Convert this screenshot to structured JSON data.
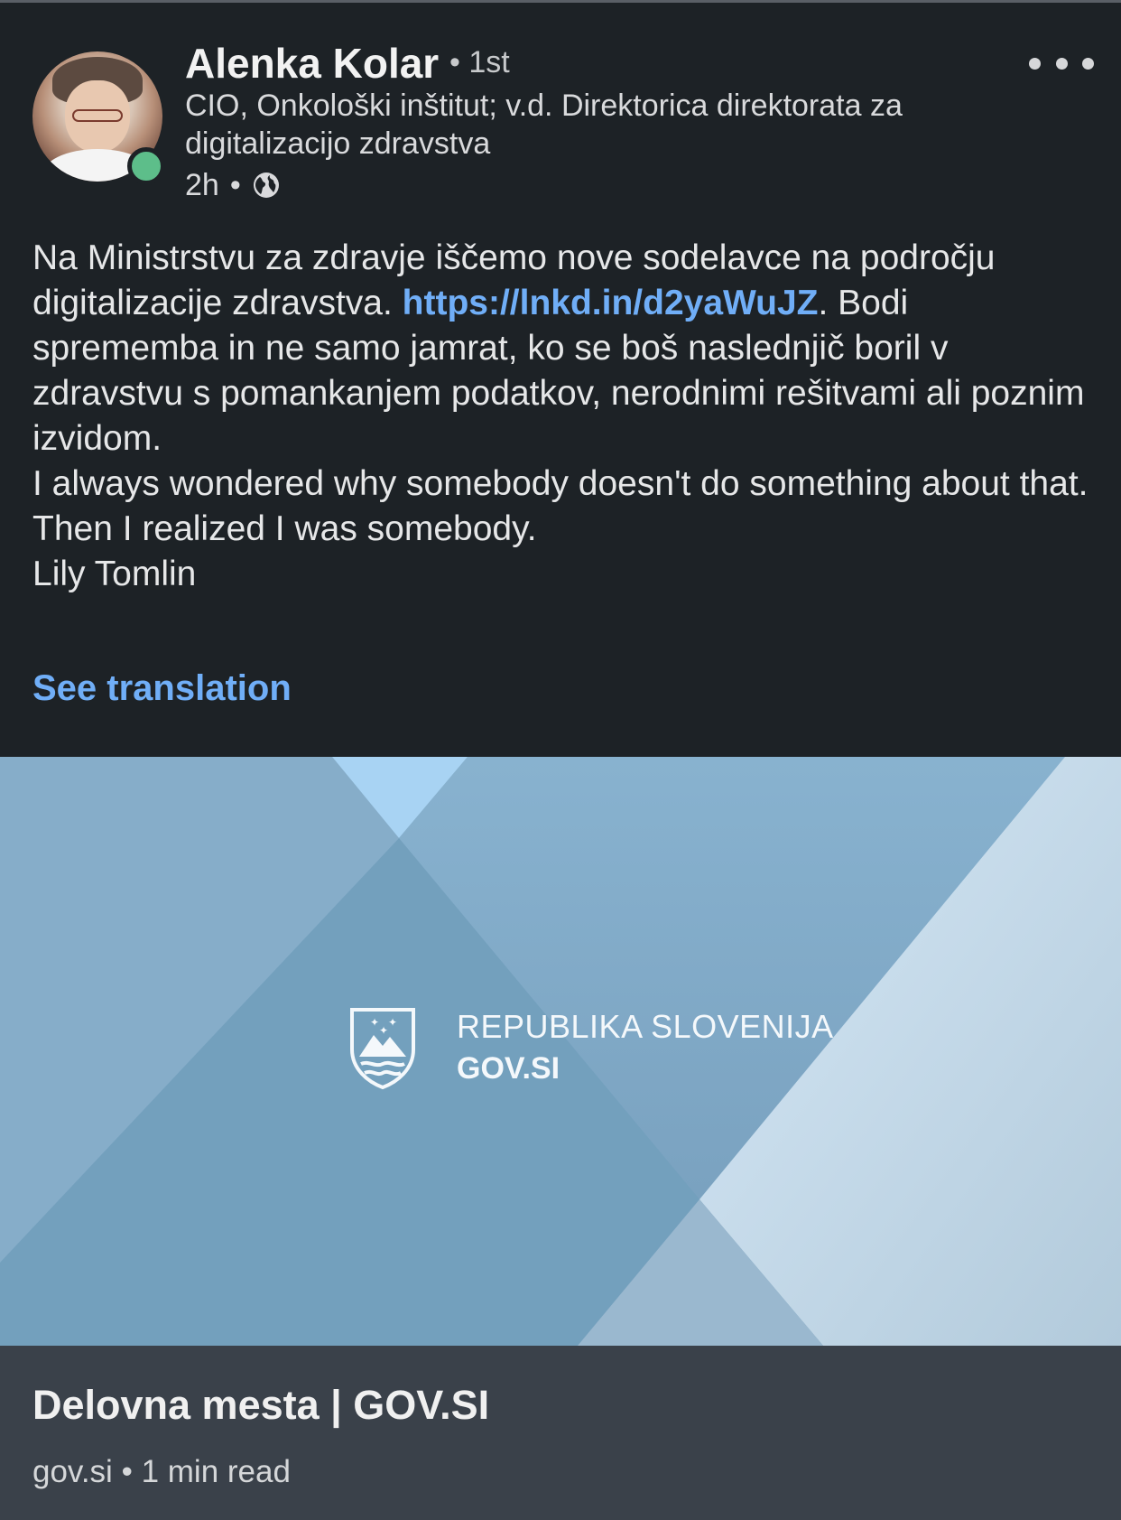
{
  "post": {
    "author_name": "Alenka Kolar",
    "connection_degree": "• 1st",
    "headline": "CIO, Onkološki inštitut; v.d. Direktorica direktorata za digitalizacijo zdravstva",
    "time_ago": "2h",
    "meta_separator": "•",
    "visibility_icon": "globe-icon",
    "more_icon": "more-options-icon",
    "body_part1": "Na Ministrstvu za zdravje iščemo nove sodelavce na področju digitalizacije zdravstva.  ",
    "body_link": "https://lnkd.in/d2yaWuJZ",
    "body_part2": ". Bodi sprememba in ne samo jamrat, ko se boš naslednjič boril v zdravstvu s pomankanjem podatkov, nerodnimi rešitvami ali poznim izvidom.",
    "quote": "I always wondered why somebody doesn't do something about that. Then I realized I was somebody.",
    "quote_author": "Lily Tomlin",
    "see_translation": "See translation",
    "link_color": "#70aef7",
    "online_status_color": "#5dbe8a"
  },
  "link_card": {
    "image_logo_line1": "REPUBLIKA SLOVENIJA",
    "image_logo_line2": "GOV.SI",
    "image_logo_icon": "slovenia-coat-of-arms-icon",
    "title": "Delovna mesta | GOV.SI",
    "source": "gov.si",
    "separator": "•",
    "read_time": "1 min read"
  }
}
